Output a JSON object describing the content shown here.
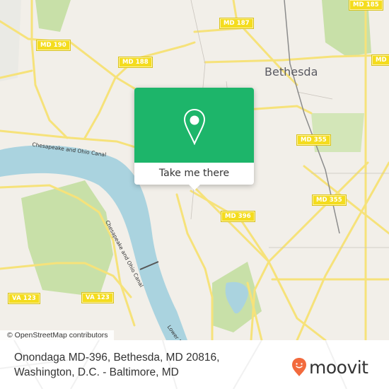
{
  "map": {
    "city_label": "Bethesda",
    "road_shields": [
      {
        "id": "md-190",
        "label": "MD 190"
      },
      {
        "id": "md-188",
        "label": "MD 188"
      },
      {
        "id": "md-187",
        "label": "MD 187"
      },
      {
        "id": "md-185",
        "label": "MD 185"
      },
      {
        "id": "md-355-a",
        "label": "MD 355"
      },
      {
        "id": "md-355-b",
        "label": "MD 355"
      },
      {
        "id": "md-355-c",
        "label": "MD"
      },
      {
        "id": "md-396",
        "label": "MD 396"
      },
      {
        "id": "va-123-a",
        "label": "VA 123"
      },
      {
        "id": "va-123-b",
        "label": "VA 123"
      }
    ],
    "waterway_labels": {
      "canal_top": "Chesapeake and Ohio Canal",
      "canal_river": "Chesapeake and Ohio Canal",
      "lower_potomac": "Lower Poto"
    },
    "attribution": "© OpenStreetMap contributors",
    "colors": {
      "land": "#f2efe9",
      "water": "#aad3df",
      "park": "#c8e0a8",
      "road": "#f6e27a"
    }
  },
  "popup": {
    "icon": "map-pin-icon",
    "button_label": "Take me there",
    "accent_color": "#1db56a"
  },
  "footer": {
    "address_line1": "Onondaga MD-396, Bethesda, MD 20816,",
    "address_line2": "Washington, D.C. - Baltimore, MD",
    "brand": "moovit",
    "brand_color": "#f26a3d"
  }
}
